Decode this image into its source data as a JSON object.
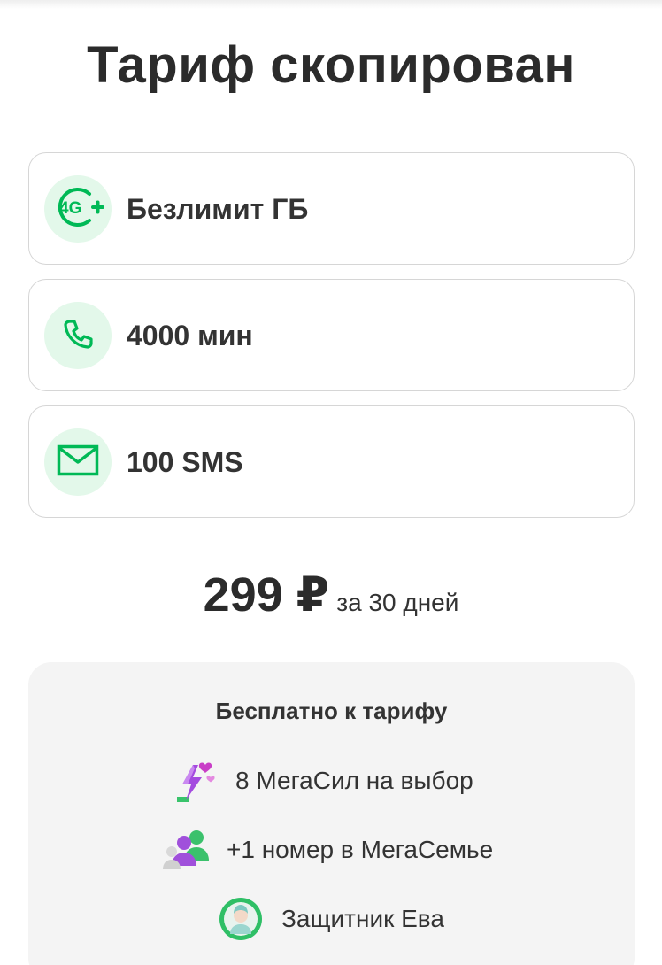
{
  "page": {
    "title": "Тариф скопирован"
  },
  "features": [
    {
      "icon": "4g-plus-icon",
      "label": "Безлимит ГБ"
    },
    {
      "icon": "phone-icon",
      "label": "4000 мин"
    },
    {
      "icon": "envelope-icon",
      "label": "100 SMS"
    }
  ],
  "price": {
    "amount": "299 ₽",
    "period": "за 30 дней"
  },
  "bonus": {
    "title": "Бесплатно к тарифу",
    "items": [
      {
        "icon": "lightning-hearts-icon",
        "label": "8 МегаСил на выбор"
      },
      {
        "icon": "family-people-icon",
        "label": "+1 номер в МегаСемье"
      },
      {
        "icon": "eva-avatar-icon",
        "label": "Защитник Ева"
      }
    ]
  },
  "colors": {
    "accent": "#00b956",
    "icon_bg": "#e3f8ea",
    "purple": "#9b3dd8",
    "card_bg": "#f4f4f4",
    "text": "#333333"
  }
}
